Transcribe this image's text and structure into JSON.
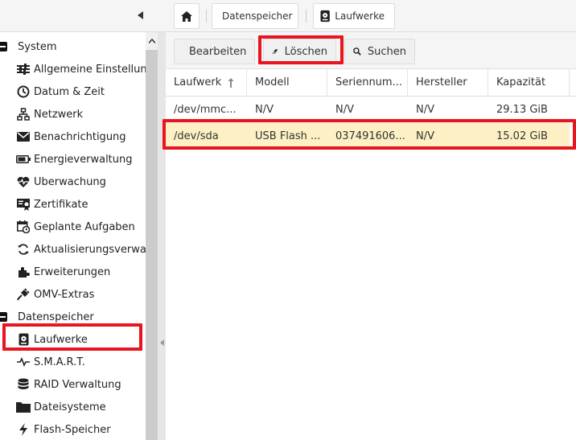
{
  "topbar": {
    "breadcrumbs": [
      {
        "label": "Datenspeicher"
      },
      {
        "label": "Laufwerke"
      }
    ]
  },
  "sidebar": {
    "items": [
      {
        "label": "System",
        "type": "group"
      },
      {
        "label": "Allgemeine Einstellungen",
        "icon": "sliders-icon"
      },
      {
        "label": "Datum & Zeit",
        "icon": "clock-icon"
      },
      {
        "label": "Netzwerk",
        "icon": "network-icon"
      },
      {
        "label": "Benachrichtigung",
        "icon": "envelope-icon"
      },
      {
        "label": "Energieverwaltung",
        "icon": "battery-icon"
      },
      {
        "label": "Überwachung",
        "icon": "heartbeat-icon"
      },
      {
        "label": "Zertifikate",
        "icon": "certificate-icon"
      },
      {
        "label": "Geplante Aufgaben",
        "icon": "calendar-clock-icon"
      },
      {
        "label": "Aktualisierungsverwaltung",
        "icon": "refresh-icon"
      },
      {
        "label": "Erweiterungen",
        "icon": "puzzle-icon"
      },
      {
        "label": "OMV-Extras",
        "icon": "plug-icon"
      },
      {
        "label": "Datenspeicher",
        "type": "group"
      },
      {
        "label": "Laufwerke",
        "icon": "hdd-icon"
      },
      {
        "label": "S.M.A.R.T.",
        "icon": "pulse-icon"
      },
      {
        "label": "RAID Verwaltung",
        "icon": "database-icon"
      },
      {
        "label": "Dateisysteme",
        "icon": "folder-icon"
      },
      {
        "label": "Flash-Speicher",
        "icon": "bolt-icon"
      }
    ]
  },
  "toolbar": {
    "edit_label": "Bearbeiten",
    "delete_label": "Löschen",
    "search_label": "Suchen"
  },
  "grid": {
    "columns": [
      "Laufwerk",
      "Modell",
      "Seriennum...",
      "Hersteller",
      "Kapazität"
    ],
    "rows": [
      [
        "/dev/mmc...",
        "N/V",
        "N/V",
        "N/V",
        "29.13 GiB"
      ],
      [
        "/dev/sda",
        "USB Flash ...",
        "037491606...",
        "N/V",
        "15.02 GiB"
      ]
    ],
    "selected_row": 1,
    "sort_column": "Laufwerk",
    "sort_direction": "ascending"
  },
  "colors": {
    "highlight": "#e8141e",
    "selected_row": "#fcf0c4"
  }
}
